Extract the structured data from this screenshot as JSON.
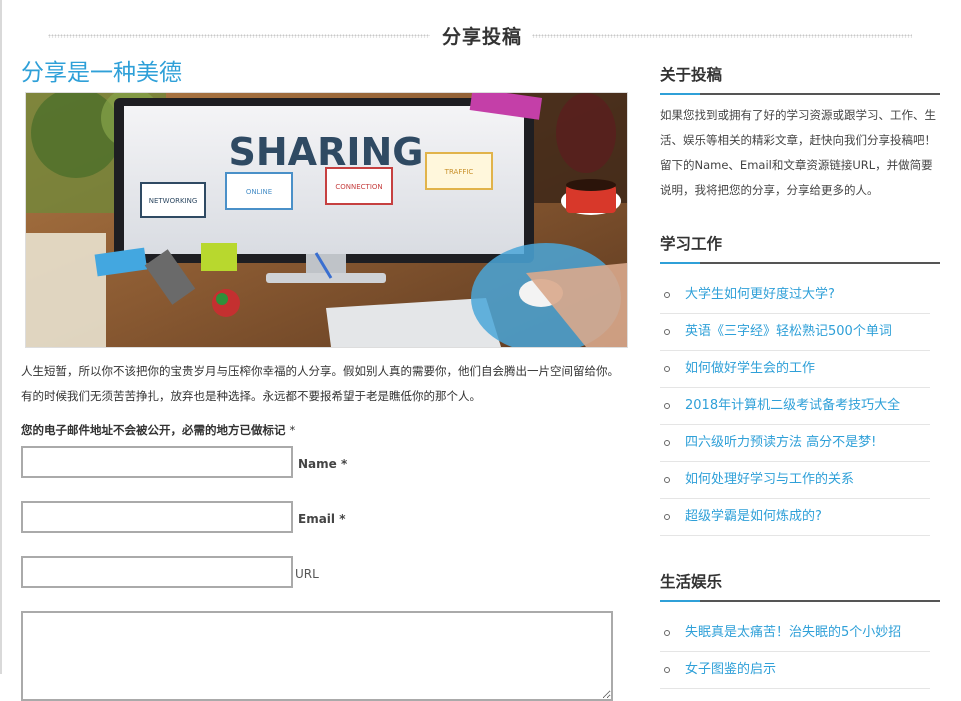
{
  "page": {
    "heading": "分享投稿"
  },
  "post": {
    "title": "分享是一种美德",
    "image": {
      "alt": "SHARING",
      "headline": "SHARING",
      "cards": [
        "NETWORKING",
        "ONLINE",
        "CONNECTION",
        "TRAFFIC"
      ]
    },
    "intro": "人生短暂，所以你不该把你的宝贵岁月与压榨你幸福的人分享。假如别人真的需要你，他们自会腾出一片空间留给你。有的时候我们无须苦苦挣扎，放弃也是种选择。永远都不要报希望于老是瞧低你的那个人。"
  },
  "form": {
    "note": "您的电子邮件地址不会被公开，必需的地方已做标记",
    "required_mark": "*",
    "name_label": "Name *",
    "email_label": "Email *",
    "url_label": "URL",
    "name_value": "",
    "email_value": "",
    "url_value": "",
    "comment_value": ""
  },
  "sidebar": {
    "about": {
      "title": "关于投稿",
      "text": "如果您找到或拥有了好的学习资源或跟学习、工作、生活、娱乐等相关的精彩文章，赶快向我们分享投稿吧！留下的Name、Email和文章资源链接URL，并做简要说明，我将把您的分享，分享给更多的人。"
    },
    "study": {
      "title": "学习工作",
      "items": [
        "大学生如何更好度过大学?",
        "英语《三字经》轻松熟记500个单词",
        "如何做好学生会的工作",
        "2018年计算机二级考试备考技巧大全",
        "四六级听力预读方法 高分不是梦!",
        "如何处理好学习与工作的关系",
        "超级学霸是如何炼成的?"
      ]
    },
    "life": {
      "title": "生活娱乐",
      "items": [
        "失眠真是太痛苦！治失眠的5个小妙招",
        "女子图鉴的启示"
      ]
    }
  },
  "colors": {
    "accent": "#2fa0d8",
    "text": "#333333",
    "border": "#aaaaaa"
  }
}
